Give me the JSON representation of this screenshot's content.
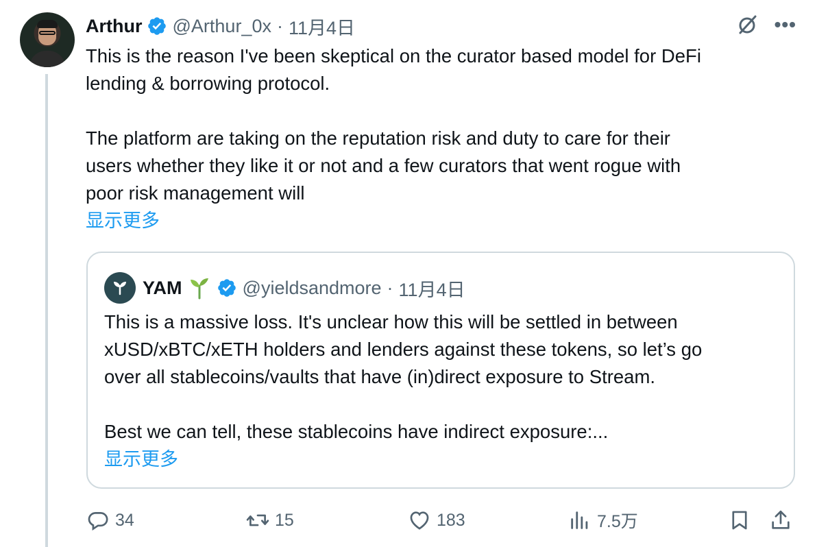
{
  "tweet": {
    "author_name": "Arthur",
    "handle": "@Arthur_0x",
    "separator": "·",
    "date": "11月4日",
    "text_p1": "This is the reason I've been skeptical on the curator based model for DeFi\nlending & borrowing protocol.",
    "text_p2": "The platform are taking on the reputation risk and duty to care for their\nusers whether they like it or not and a few curators that went rogue with\npoor risk management will",
    "show_more": "显示更多"
  },
  "quote": {
    "author_name": "YAM",
    "handle": "@yieldsandmore",
    "separator": "·",
    "date": "11月4日",
    "text_p1": "This is a massive loss. It's unclear how this will be settled in between\nxUSD/xBTC/xETH holders and lenders against these tokens, so let’s go\nover all stablecoins/vaults that have (in)direct exposure to Stream.",
    "text_p2": "Best we can tell, these stablecoins have indirect exposure:...",
    "show_more": "显示更多"
  },
  "actions": {
    "replies": "34",
    "reposts": "15",
    "likes": "183",
    "views": "7.5万"
  },
  "icons": [
    "verified-badge-icon",
    "grok-icon",
    "more-icon",
    "sprout-icon",
    "reply-icon",
    "repost-icon",
    "like-icon",
    "views-icon",
    "bookmark-icon",
    "share-icon"
  ],
  "colors": {
    "link": "#1d9bf0",
    "muted": "#536471",
    "text": "#0f1419",
    "border": "#cfd9de"
  }
}
